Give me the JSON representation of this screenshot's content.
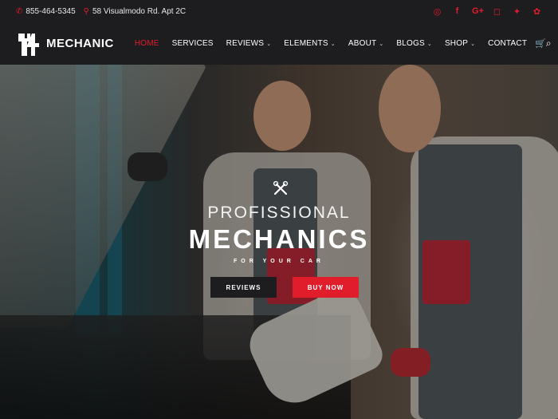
{
  "topbar": {
    "phone": "855-464-5345",
    "address": "58 Visualmodo Rd. Apt 2C",
    "socials": [
      {
        "icon": "dribbble-icon",
        "glyph": "◎"
      },
      {
        "icon": "facebook-icon",
        "glyph": "f"
      },
      {
        "icon": "google-plus-icon",
        "glyph": "G+"
      },
      {
        "icon": "instagram-icon",
        "glyph": "◻"
      },
      {
        "icon": "twitter-icon",
        "glyph": "✦"
      },
      {
        "icon": "yelp-icon",
        "glyph": "✿"
      }
    ]
  },
  "nav": {
    "logo_text": "MECHANIC",
    "items": [
      {
        "label": "HOME",
        "active": true,
        "dropdown": false
      },
      {
        "label": "SERVICES",
        "active": false,
        "dropdown": false
      },
      {
        "label": "REVIEWS",
        "active": false,
        "dropdown": true
      },
      {
        "label": "ELEMENTS",
        "active": false,
        "dropdown": true
      },
      {
        "label": "ABOUT",
        "active": false,
        "dropdown": true
      },
      {
        "label": "BLOGS",
        "active": false,
        "dropdown": true
      },
      {
        "label": "SHOP",
        "active": false,
        "dropdown": true
      },
      {
        "label": "CONTACT",
        "active": false,
        "dropdown": false
      }
    ]
  },
  "hero": {
    "pretitle": "PROFISSIONAL",
    "title": "MECHANICS",
    "subtitle": "FOR YOUR CAR",
    "button_reviews": "REVIEWS",
    "button_buy": "BUY NOW"
  },
  "colors": {
    "accent": "#e21d2b",
    "bar_bg": "#1d1d1f"
  }
}
